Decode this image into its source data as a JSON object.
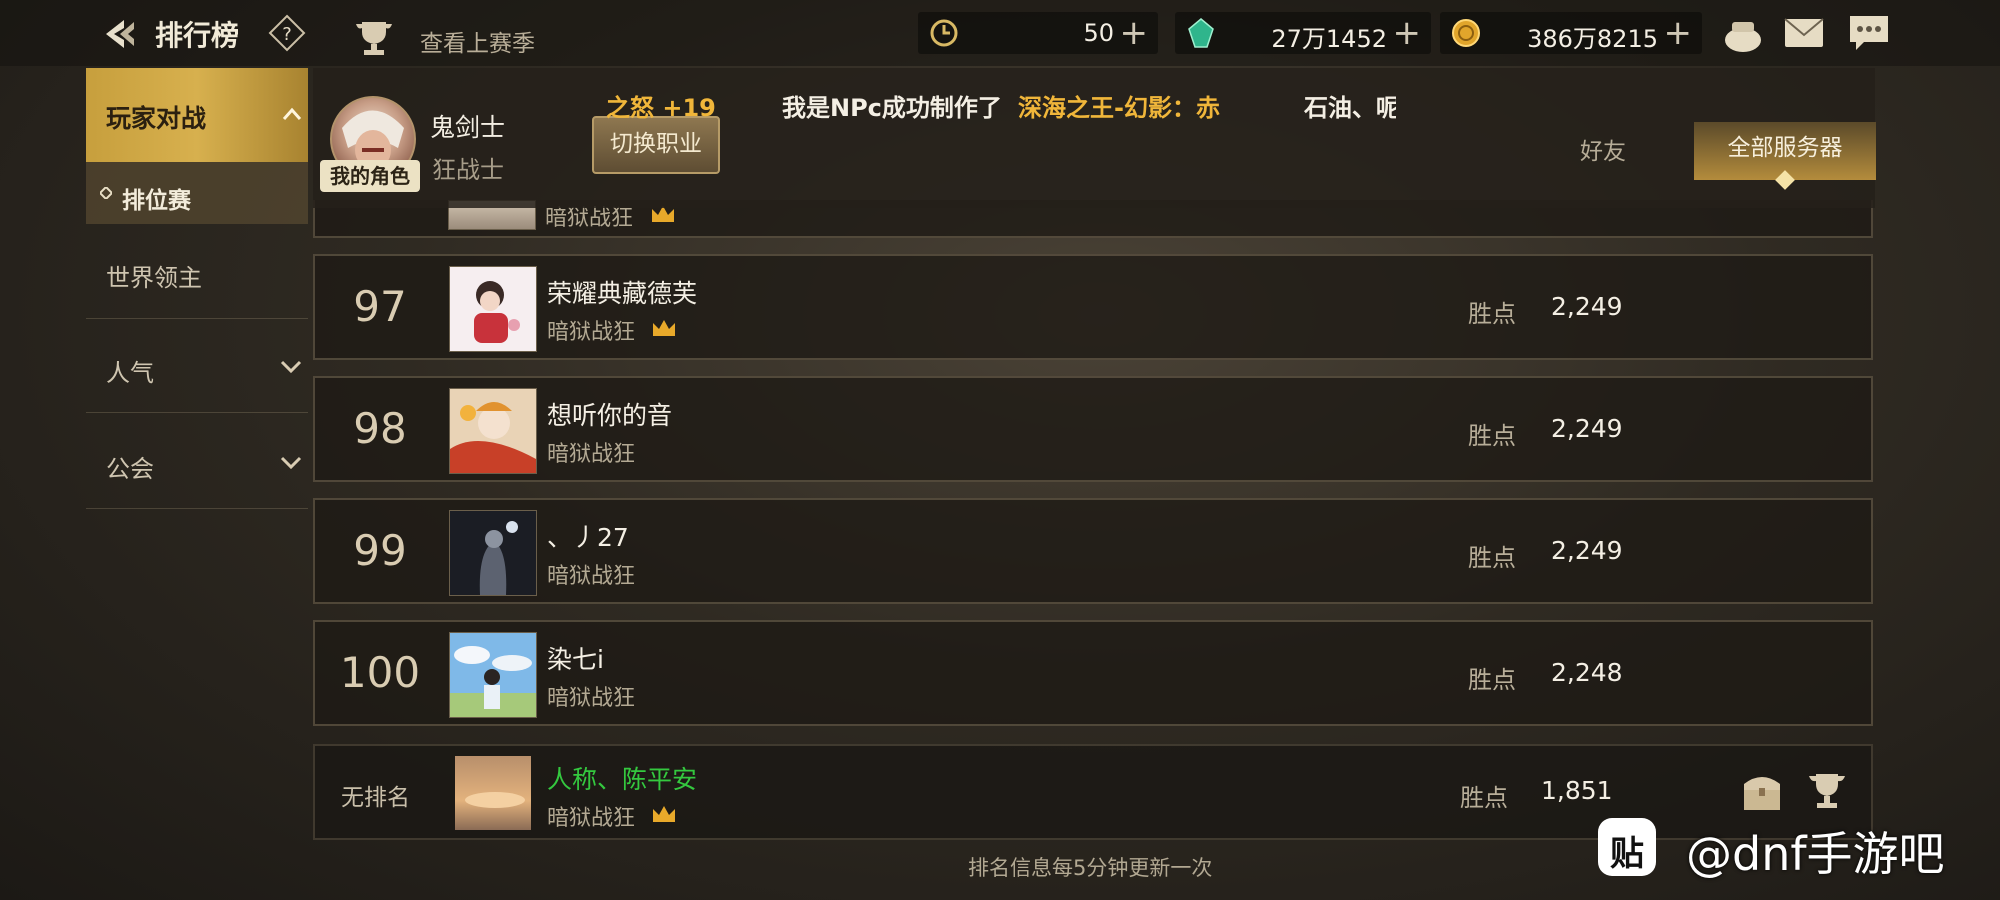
{
  "header": {
    "title": "排行榜",
    "help": "?",
    "last_season": "查看上赛季",
    "currencies": [
      {
        "icon": "clock-currency-icon",
        "value": "50",
        "plus": "+"
      },
      {
        "icon": "green-gem-icon",
        "value": "27万1452",
        "plus": "+"
      },
      {
        "icon": "gold-coin-icon",
        "value": "386万8215",
        "plus": "+"
      }
    ],
    "icons": [
      "pouch-icon",
      "mail-icon",
      "chat-icon"
    ]
  },
  "sidebar": {
    "items": [
      {
        "label": "玩家对战",
        "expanded": true
      },
      {
        "label": "排位赛",
        "selected": true
      },
      {
        "label": "世界领主"
      },
      {
        "label": "人气"
      },
      {
        "label": "公会"
      }
    ]
  },
  "profile": {
    "name": "鬼剑士",
    "class": "狂战士",
    "badge": "我的角色",
    "switch_button": "切换职业"
  },
  "ticker": {
    "part1": "之怒 +19",
    "part2": "我是NPc成功制作了",
    "part3": "深海之王-幻影：赤",
    "part4": "石油、呢"
  },
  "tabs": {
    "friends": "好友",
    "all_servers": "全部服务器"
  },
  "partial_row": {
    "guild": "暗狱战狂"
  },
  "rows": [
    {
      "rank": "97",
      "name": "荣耀典藏德芙",
      "guild": "暗狱战狂",
      "crown": true,
      "points_label": "胜点",
      "points": "2,249"
    },
    {
      "rank": "98",
      "name": "想听你的音",
      "guild": "暗狱战狂",
      "crown": false,
      "points_label": "胜点",
      "points": "2,249"
    },
    {
      "rank": "99",
      "name": "、丿27",
      "guild": "暗狱战狂",
      "crown": false,
      "points_label": "胜点",
      "points": "2,249"
    },
    {
      "rank": "100",
      "name": "染七i",
      "guild": "暗狱战狂",
      "crown": false,
      "points_label": "胜点",
      "points": "2,248"
    }
  ],
  "my_row": {
    "rank": "无排名",
    "name": "人称、陈平安",
    "guild": "暗狱战狂",
    "points_label": "胜点",
    "points": "1,851"
  },
  "footer": {
    "note": "排名信息每5分钟更新一次"
  },
  "watermark": {
    "logo": "贴",
    "text": "@dnf手游吧"
  }
}
